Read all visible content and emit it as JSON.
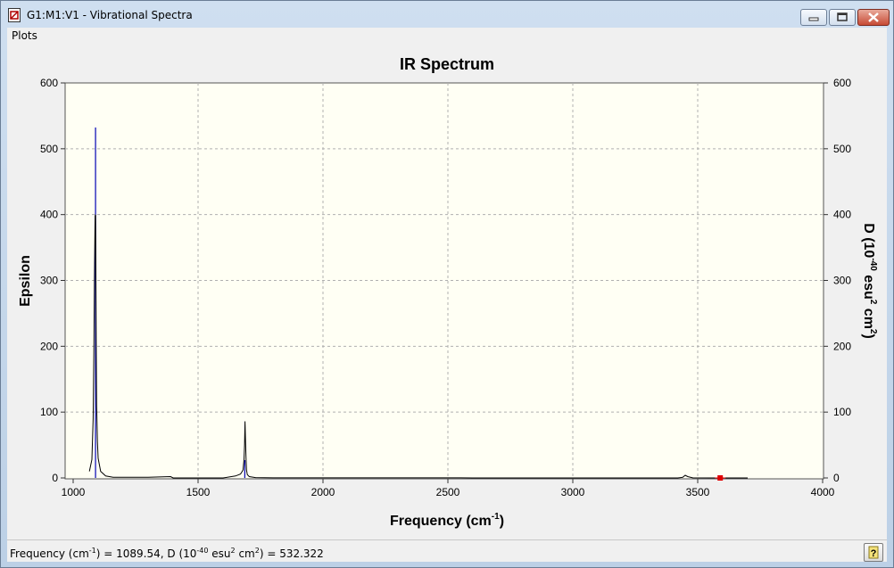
{
  "window": {
    "title": "G1:M1:V1 - Vibrational Spectra",
    "icon": "document-chart-icon"
  },
  "menu": {
    "items": [
      "Plots"
    ]
  },
  "status": {
    "freq_label": "Frequency (cm",
    "freq_sup": "-1",
    "mid": ") = 1089.54, D (10",
    "d_sup": "-40",
    "esu": " esu",
    "esu_sup": "2",
    "cm": " cm",
    "cm_sup": "2",
    "tail": ") = 532.322"
  },
  "chart_data": {
    "type": "line",
    "title": "IR Spectrum",
    "xlabel": "Frequency (cm-1)",
    "xlabel_main": "Frequency (cm",
    "xlabel_sup": "-1",
    "xlabel_end": ")",
    "ylabel": "Epsilon",
    "y2label": "D (10-40 esu2 cm2)",
    "y2label_parts": [
      "D (10",
      "-40",
      " esu",
      "2",
      " cm",
      "2",
      ")"
    ],
    "xlim": [
      1000,
      4000
    ],
    "ylim": [
      0,
      600
    ],
    "y2lim": [
      0,
      600
    ],
    "xticks": [
      1000,
      1500,
      2000,
      2500,
      3000,
      3500,
      4000
    ],
    "yticks": [
      0,
      100,
      200,
      300,
      400,
      500,
      600
    ],
    "grid": true,
    "series": [
      {
        "color": "#000000",
        "x": [
          1065,
          1075,
          1080,
          1083,
          1085,
          1087,
          1088,
          1089.5,
          1091,
          1092,
          1094,
          1097,
          1100,
          1110,
          1130,
          1160,
          1300,
          1390,
          1400,
          1600,
          1650,
          1670,
          1680,
          1684,
          1686,
          1688,
          1690,
          1692,
          1694,
          1697,
          1705,
          1730,
          1800,
          2550,
          2600,
          3420,
          3440,
          3450,
          3460,
          3480,
          3600,
          3700
        ],
        "y": [
          10,
          28,
          90,
          190,
          300,
          375,
          398,
          400,
          300,
          210,
          110,
          55,
          30,
          10,
          3,
          1,
          1,
          2,
          0,
          0,
          3,
          6,
          12,
          28,
          50,
          86,
          55,
          28,
          12,
          5,
          2,
          0.5,
          0.2,
          0.2,
          0,
          0,
          1,
          4,
          2,
          0.2,
          0,
          0
        ]
      }
    ],
    "sticks": [
      {
        "x": 1089.54,
        "d": 532.322,
        "color": "#0000b4"
      },
      {
        "x": 1687,
        "d": 27,
        "color": "#0000b4"
      }
    ],
    "marker": {
      "x": 3590,
      "y": 0,
      "color": "#e00000"
    }
  }
}
